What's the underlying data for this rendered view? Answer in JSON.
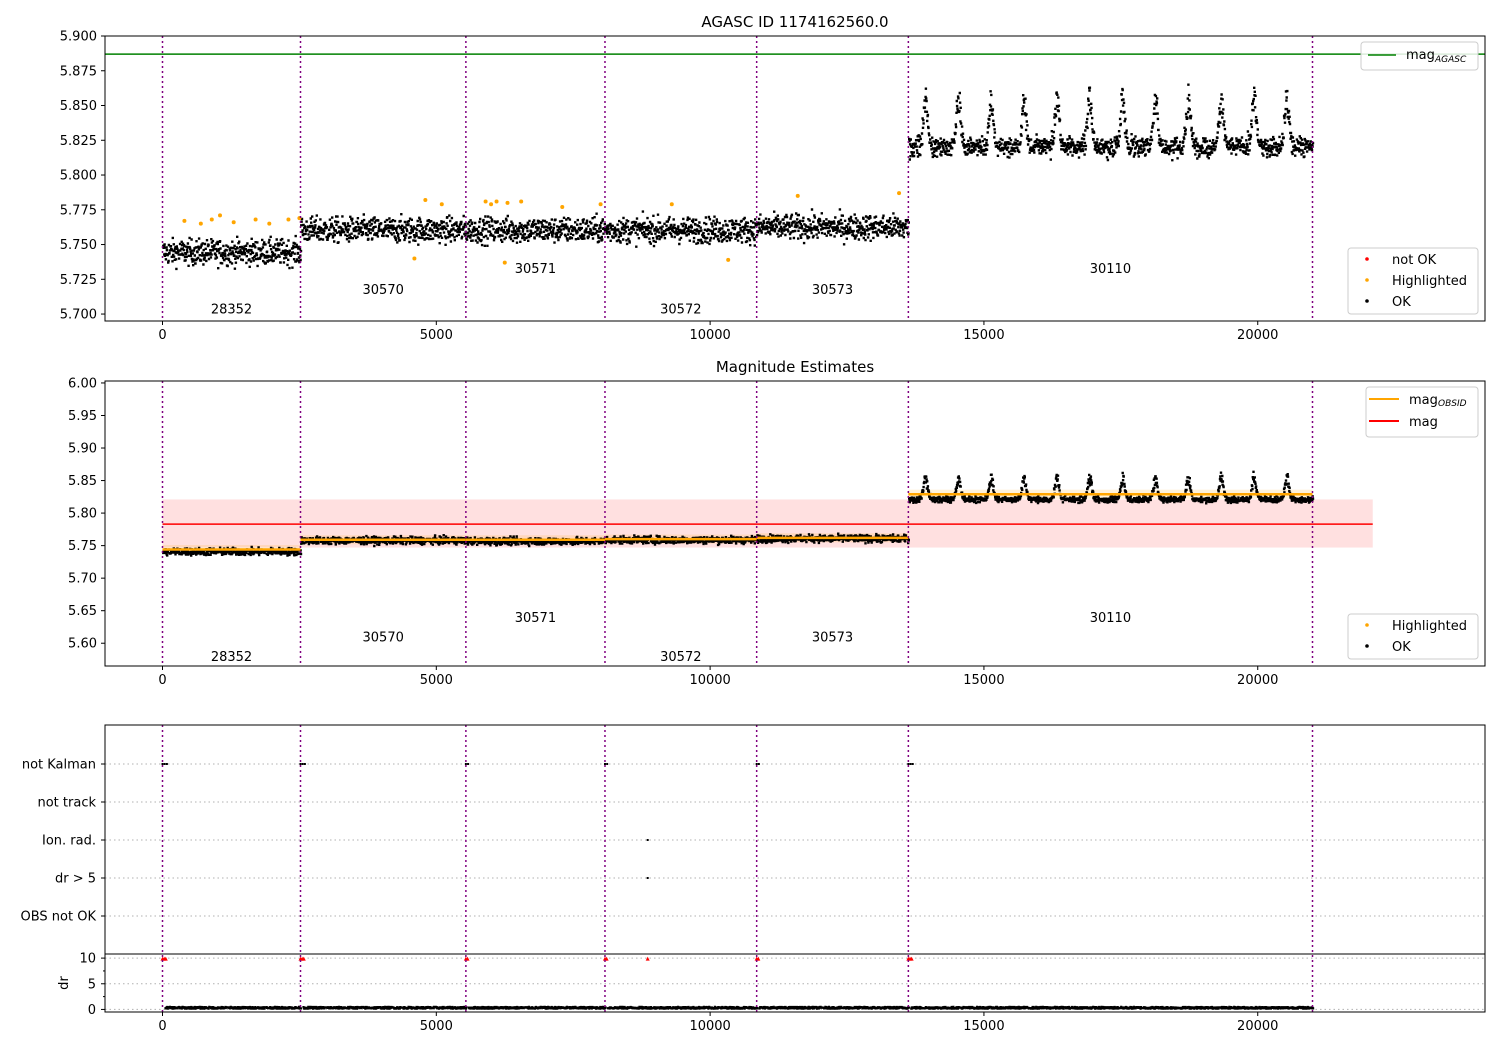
{
  "chart_data": [
    {
      "type": "scatter",
      "title": "AGASC ID 1174162560.0",
      "xlim": [
        -1050,
        24150
      ],
      "ylim": [
        5.695,
        5.9
      ],
      "xticks": [
        0,
        5000,
        10000,
        15000,
        20000
      ],
      "xtick_labels": [
        "0",
        "5000",
        "10000",
        "15000",
        "20000"
      ],
      "yticks": [
        5.7,
        5.725,
        5.75,
        5.775,
        5.8,
        5.825,
        5.85,
        5.875,
        5.9
      ],
      "ytick_labels": [
        "5.700",
        "5.725",
        "5.750",
        "5.775",
        "5.800",
        "5.825",
        "5.850",
        "5.875",
        "5.900"
      ],
      "hline": {
        "y": 5.887,
        "color": "#008000"
      },
      "legend_top": {
        "placement": "top-right",
        "entries": [
          {
            "label": "mag",
            "sub": "AGASC",
            "color": "#008000",
            "kind": "line"
          }
        ]
      },
      "legend_bottom": {
        "placement": "lower-right",
        "entries": [
          {
            "label": "not OK",
            "color": "#ff0000",
            "kind": "marker"
          },
          {
            "label": "Highlighted",
            "color": "#ffa500",
            "kind": "marker"
          },
          {
            "label": "OK",
            "color": "#000000",
            "kind": "marker"
          }
        ]
      },
      "obs_boundaries": [
        0,
        2520,
        5540,
        8080,
        10850,
        13620,
        21000
      ],
      "obs_labels": [
        {
          "text": "28352",
          "x": 1260,
          "y": 5.704
        },
        {
          "text": "30570",
          "x": 4030,
          "y": 5.718
        },
        {
          "text": "30571",
          "x": 6810,
          "y": 5.733
        },
        {
          "text": "30572",
          "x": 9465,
          "y": 5.704
        },
        {
          "text": "30573",
          "x": 12235,
          "y": 5.718
        },
        {
          "text": "30110",
          "x": 17310,
          "y": 5.733
        }
      ],
      "segments": [
        {
          "x0": 0,
          "x1": 2520,
          "mean": 5.745,
          "spread": 0.018,
          "osc": 0
        },
        {
          "x0": 2520,
          "x1": 5540,
          "mean": 5.761,
          "spread": 0.018,
          "osc": 0
        },
        {
          "x0": 5540,
          "x1": 8080,
          "mean": 5.761,
          "spread": 0.018,
          "osc": 0
        },
        {
          "x0": 8080,
          "x1": 10850,
          "mean": 5.761,
          "spread": 0.018,
          "osc": 0
        },
        {
          "x0": 10850,
          "x1": 13620,
          "mean": 5.763,
          "spread": 0.018,
          "osc": 0
        },
        {
          "x0": 13620,
          "x1": 21000,
          "mean": 5.821,
          "spread": 0.014,
          "osc": 0.04,
          "period": 600
        }
      ],
      "highlighted_points": [
        [
          400,
          5.767
        ],
        [
          700,
          5.765
        ],
        [
          900,
          5.768
        ],
        [
          1050,
          5.771
        ],
        [
          1300,
          5.766
        ],
        [
          1700,
          5.768
        ],
        [
          1950,
          5.765
        ],
        [
          2300,
          5.768
        ],
        [
          2500,
          5.769
        ],
        [
          4800,
          5.782
        ],
        [
          5100,
          5.779
        ],
        [
          5900,
          5.781
        ],
        [
          6000,
          5.779
        ],
        [
          6100,
          5.781
        ],
        [
          6300,
          5.78
        ],
        [
          6550,
          5.781
        ],
        [
          7300,
          5.777
        ],
        [
          8000,
          5.779
        ],
        [
          9300,
          5.779
        ],
        [
          10330,
          5.739
        ],
        [
          11600,
          5.785
        ],
        [
          13450,
          5.787
        ],
        [
          6250,
          5.737
        ],
        [
          4600,
          5.74
        ]
      ]
    },
    {
      "type": "scatter",
      "title": "Magnitude Estimates",
      "xlim": [
        -1050,
        24150
      ],
      "ylim": [
        5.565,
        6.003
      ],
      "xticks": [
        0,
        5000,
        10000,
        15000,
        20000
      ],
      "xtick_labels": [
        "0",
        "5000",
        "10000",
        "15000",
        "20000"
      ],
      "yticks": [
        5.6,
        5.65,
        5.7,
        5.75,
        5.8,
        5.85,
        5.9,
        5.95,
        6.0
      ],
      "ytick_labels": [
        "5.60",
        "5.65",
        "5.70",
        "5.75",
        "5.80",
        "5.85",
        "5.90",
        "5.95",
        "6.00"
      ],
      "mag": {
        "value": 5.783,
        "band": [
          5.747,
          5.821
        ],
        "x_end": 22100,
        "color": "#ff0000"
      },
      "obsid_mags": [
        {
          "x0": 0,
          "x1": 2520,
          "y": 5.744
        },
        {
          "x0": 2520,
          "x1": 5540,
          "y": 5.759
        },
        {
          "x0": 5540,
          "x1": 8080,
          "y": 5.759
        },
        {
          "x0": 8080,
          "x1": 10850,
          "y": 5.76
        },
        {
          "x0": 10850,
          "x1": 13620,
          "y": 5.762
        },
        {
          "x0": 13620,
          "x1": 21000,
          "y": 5.829
        }
      ],
      "legend_top": {
        "placement": "top-right",
        "entries": [
          {
            "label": "mag",
            "sub": "OBSID",
            "color": "#ffa500",
            "kind": "line"
          },
          {
            "label": "mag",
            "sub": "",
            "color": "#ff0000",
            "kind": "line"
          }
        ]
      },
      "legend_bottom": {
        "placement": "lower-right",
        "entries": [
          {
            "label": "Highlighted",
            "color": "#ffa500",
            "kind": "marker"
          },
          {
            "label": "OK",
            "color": "#000000",
            "kind": "marker"
          }
        ]
      },
      "obs_labels": [
        {
          "text": "28352",
          "x": 1260,
          "y": 5.58
        },
        {
          "text": "30570",
          "x": 4030,
          "y": 5.61
        },
        {
          "text": "30571",
          "x": 6810,
          "y": 5.64
        },
        {
          "text": "30572",
          "x": 9465,
          "y": 5.58
        },
        {
          "text": "30573",
          "x": 12235,
          "y": 5.61
        },
        {
          "text": "30110",
          "x": 17310,
          "y": 5.64
        }
      ],
      "segments": [
        {
          "x0": 0,
          "x1": 2520,
          "mean": 5.742,
          "spread": 0.011,
          "osc": 0
        },
        {
          "x0": 2520,
          "x1": 5540,
          "mean": 5.759,
          "spread": 0.011,
          "osc": 0
        },
        {
          "x0": 5540,
          "x1": 8080,
          "mean": 5.758,
          "spread": 0.011,
          "osc": 0
        },
        {
          "x0": 8080,
          "x1": 10850,
          "mean": 5.76,
          "spread": 0.011,
          "osc": 0
        },
        {
          "x0": 10850,
          "x1": 13620,
          "mean": 5.762,
          "spread": 0.011,
          "osc": 0
        },
        {
          "x0": 13620,
          "x1": 21000,
          "mean": 5.822,
          "spread": 0.009,
          "osc": 0.038,
          "period": 600
        }
      ]
    },
    {
      "type": "scatter",
      "title": "",
      "xlim": [
        -1050,
        24150
      ],
      "xticks": [
        0,
        5000,
        10000,
        15000,
        20000
      ],
      "xtick_labels": [
        "0",
        "5000",
        "10000",
        "15000",
        "20000"
      ],
      "flag_rows": [
        "not Kalman",
        "not track",
        "Ion. rad.",
        "dr > 5",
        "OBS not OK"
      ],
      "flags": [
        {
          "row": "not Kalman",
          "x": [
            0,
            40,
            80,
            2520,
            2560,
            2600,
            5540,
            5580,
            8080,
            8120,
            10850,
            10890,
            13620,
            13660,
            13700
          ]
        },
        {
          "row": "Ion. rad.",
          "x": [
            8860
          ]
        },
        {
          "row": "dr > 5",
          "x": [
            8860
          ]
        }
      ],
      "dr": {
        "ylabel": "dr",
        "ylim": [
          -0.5,
          10.8
        ],
        "yticks": [
          0,
          5,
          10
        ],
        "ytick_labels": [
          "0",
          "5",
          "10"
        ],
        "high_x": [
          0,
          30,
          60,
          2520,
          2550,
          2580,
          5540,
          5570,
          8080,
          8110,
          8860,
          10850,
          10880,
          13620,
          13650,
          13680
        ],
        "high_value": 9.9,
        "baseline": 0.3
      }
    }
  ]
}
